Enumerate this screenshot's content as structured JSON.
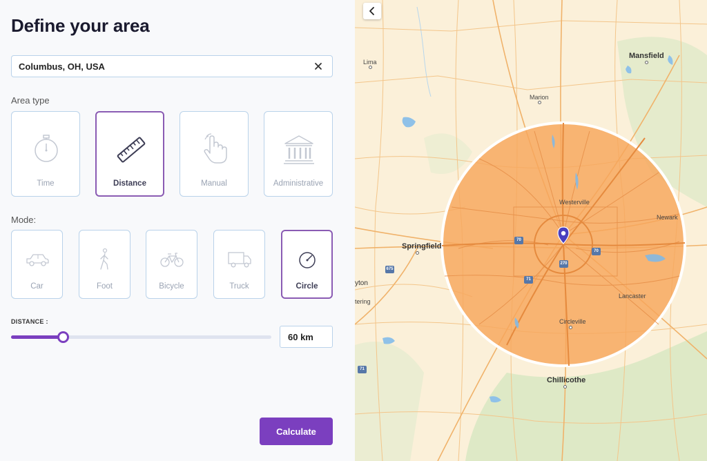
{
  "panel": {
    "title": "Define your area",
    "search": {
      "value": "Columbus, OH, USA",
      "clear_icon": "close-icon"
    },
    "area_type_label": "Area type",
    "area_types": [
      {
        "label": "Time",
        "icon": "stopwatch-icon",
        "selected": false
      },
      {
        "label": "Distance",
        "icon": "ruler-icon",
        "selected": true
      },
      {
        "label": "Manual",
        "icon": "hand-pointer-icon",
        "selected": false
      },
      {
        "label": "Administrative",
        "icon": "government-building-icon",
        "selected": false
      }
    ],
    "mode_label": "Mode:",
    "modes": [
      {
        "label": "Car",
        "icon": "car-icon",
        "selected": false
      },
      {
        "label": "Foot",
        "icon": "walking-person-icon",
        "selected": false
      },
      {
        "label": "Bicycle",
        "icon": "bicycle-icon",
        "selected": false
      },
      {
        "label": "Truck",
        "icon": "truck-icon",
        "selected": false
      },
      {
        "label": "Circle",
        "icon": "circle-radius-icon",
        "selected": true
      }
    ],
    "distance_label": "DISTANCE :",
    "distance_value": "60 km",
    "slider_fraction": 0.2,
    "calculate_label": "Calculate",
    "accent_color": "#7b3fbf"
  },
  "map": {
    "collapse_icon": "chevron-left-icon",
    "radius_fill": "#f6a65c",
    "places": {
      "mansfield": "Mansfield",
      "lima": "Lima",
      "marion": "Marion",
      "westerville": "Westerville",
      "newark": "Newark",
      "springfield": "Springfield",
      "dayton": "yton",
      "kettering": "tering",
      "lancaster": "Lancaster",
      "circleville": "Circleville",
      "chillicothe": "Chillicothe"
    },
    "shields": {
      "i70w": "70",
      "i70e": "70",
      "i270": "270",
      "i71": "71",
      "i675": "675",
      "i71sw": "71"
    }
  }
}
